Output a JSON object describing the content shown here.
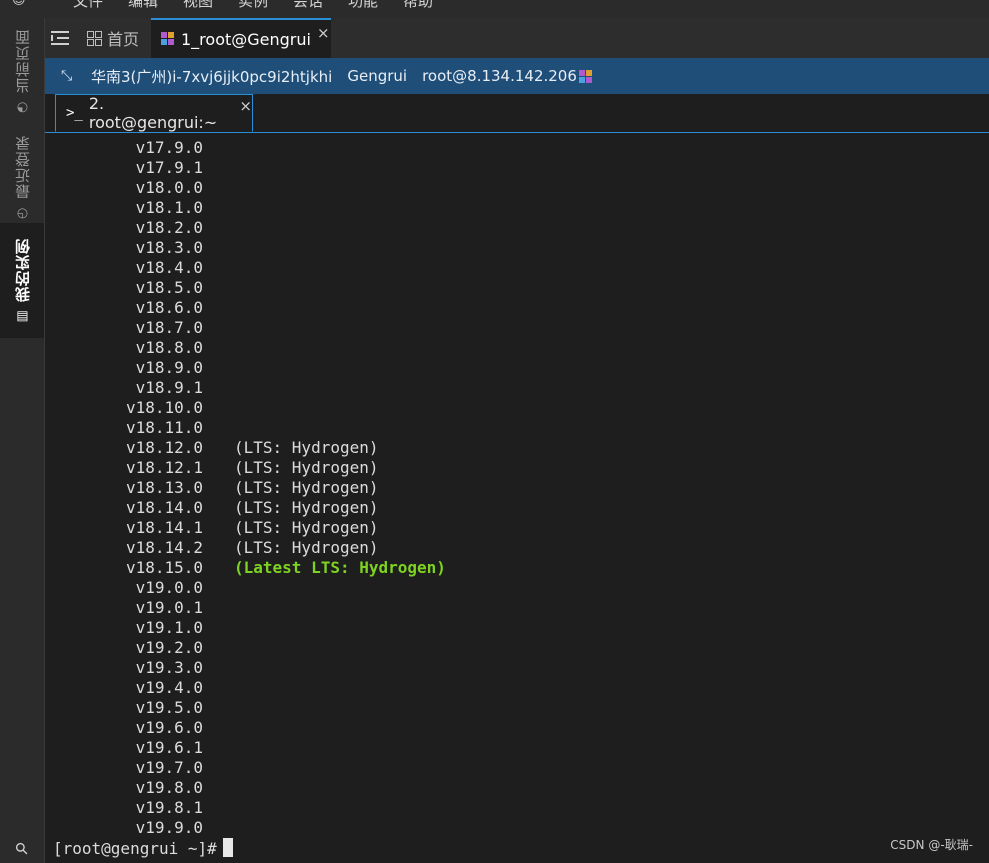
{
  "menubar": {
    "items": [
      "文件",
      "编辑",
      "视图",
      "实例",
      "会话",
      "功能",
      "帮助"
    ]
  },
  "sidebar": {
    "tabs": [
      {
        "label": "当前页面",
        "icon": "clock-icon"
      },
      {
        "label": "最近登录",
        "icon": "history-icon"
      },
      {
        "label": "我的实例",
        "icon": "server-icon"
      }
    ],
    "pin_icon": "pin-icon"
  },
  "tabbar": {
    "home_label": "首页",
    "session_tab_label": "1_root@Gengrui",
    "close_glyph": "×"
  },
  "infobar": {
    "region": "华南3(广州)i-7xvj6jjk0pc9i2htjkhi",
    "hostname": "Gengrui",
    "user_host": "root@8.134.142.206"
  },
  "subtab": {
    "label": "2. root@gengrui:~",
    "prompt_glyph": ">_",
    "close_glyph": "×"
  },
  "terminal": {
    "lines": [
      {
        "version": "v17.9.0",
        "note": ""
      },
      {
        "version": "v17.9.1",
        "note": ""
      },
      {
        "version": "v18.0.0",
        "note": ""
      },
      {
        "version": "v18.1.0",
        "note": ""
      },
      {
        "version": "v18.2.0",
        "note": ""
      },
      {
        "version": "v18.3.0",
        "note": ""
      },
      {
        "version": "v18.4.0",
        "note": ""
      },
      {
        "version": "v18.5.0",
        "note": ""
      },
      {
        "version": "v18.6.0",
        "note": ""
      },
      {
        "version": "v18.7.0",
        "note": ""
      },
      {
        "version": "v18.8.0",
        "note": ""
      },
      {
        "version": "v18.9.0",
        "note": ""
      },
      {
        "version": "v18.9.1",
        "note": ""
      },
      {
        "version": "v18.10.0",
        "note": ""
      },
      {
        "version": "v18.11.0",
        "note": ""
      },
      {
        "version": "v18.12.0",
        "note": "(LTS: Hydrogen)"
      },
      {
        "version": "v18.12.1",
        "note": "(LTS: Hydrogen)"
      },
      {
        "version": "v18.13.0",
        "note": "(LTS: Hydrogen)"
      },
      {
        "version": "v18.14.0",
        "note": "(LTS: Hydrogen)"
      },
      {
        "version": "v18.14.1",
        "note": "(LTS: Hydrogen)"
      },
      {
        "version": "v18.14.2",
        "note": "(LTS: Hydrogen)"
      },
      {
        "version": "v18.15.0",
        "note": "(Latest LTS: Hydrogen)",
        "latest": true
      },
      {
        "version": "v19.0.0",
        "note": ""
      },
      {
        "version": "v19.0.1",
        "note": ""
      },
      {
        "version": "v19.1.0",
        "note": ""
      },
      {
        "version": "v19.2.0",
        "note": ""
      },
      {
        "version": "v19.3.0",
        "note": ""
      },
      {
        "version": "v19.4.0",
        "note": ""
      },
      {
        "version": "v19.5.0",
        "note": ""
      },
      {
        "version": "v19.6.0",
        "note": ""
      },
      {
        "version": "v19.6.1",
        "note": ""
      },
      {
        "version": "v19.7.0",
        "note": ""
      },
      {
        "version": "v19.8.0",
        "note": ""
      },
      {
        "version": "v19.8.1",
        "note": ""
      },
      {
        "version": "v19.9.0",
        "note": ""
      }
    ],
    "prompt": "[root@gengrui ~]#",
    "latest_color": "#7ed321",
    "text_color": "#dcdcdc"
  },
  "watermark": "CSDN @-耿瑞-",
  "colors": {
    "infobar_bg": "#1f4e79",
    "accent": "#2a8fd6",
    "background": "#1e1e1e"
  }
}
